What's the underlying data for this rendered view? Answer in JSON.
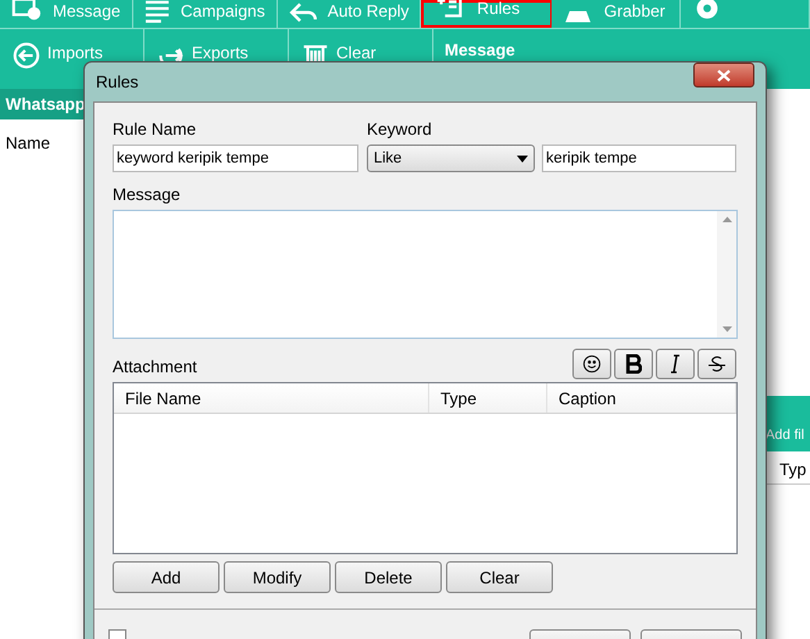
{
  "toolbar": {
    "row1": [
      {
        "label": "Message",
        "kind": "message",
        "selected": false
      },
      {
        "label": "Campaigns",
        "kind": "list",
        "selected": false
      },
      {
        "label": "Auto Reply",
        "kind": "reply",
        "selected": false
      },
      {
        "label": "Rules",
        "kind": "rules",
        "selected": true
      },
      {
        "label": "Grabber",
        "kind": "grabber",
        "selected": false
      },
      {
        "kind": "gear",
        "selected": false
      }
    ],
    "row2": [
      {
        "label": "Imports",
        "kind": "import"
      },
      {
        "label": "Exports",
        "kind": "export"
      },
      {
        "label": "Clear",
        "kind": "trash"
      }
    ],
    "section_title": "Message"
  },
  "sidebar": {
    "title": "Whatsapp",
    "column": "Name"
  },
  "right_panel": {
    "button": "Add fil",
    "column": "Typ"
  },
  "dialog": {
    "title": "Rules",
    "rule_name": {
      "label": "Rule Name",
      "value": "keyword keripik tempe"
    },
    "keyword": {
      "label": "Keyword",
      "match": "Like",
      "value": "keripik tempe"
    },
    "message": {
      "label": "Message"
    },
    "format_buttons": [
      {
        "kind": "emoji"
      },
      {
        "kind": "bold"
      },
      {
        "kind": "italic"
      },
      {
        "kind": "strike"
      }
    ],
    "attachment": {
      "label": "Attachment",
      "columns": [
        "File Name",
        "Type",
        "Caption"
      ]
    },
    "buttons": [
      "Add",
      "Modify",
      "Delete",
      "Clear"
    ],
    "footer_checkbox": {
      "checked": false
    }
  }
}
